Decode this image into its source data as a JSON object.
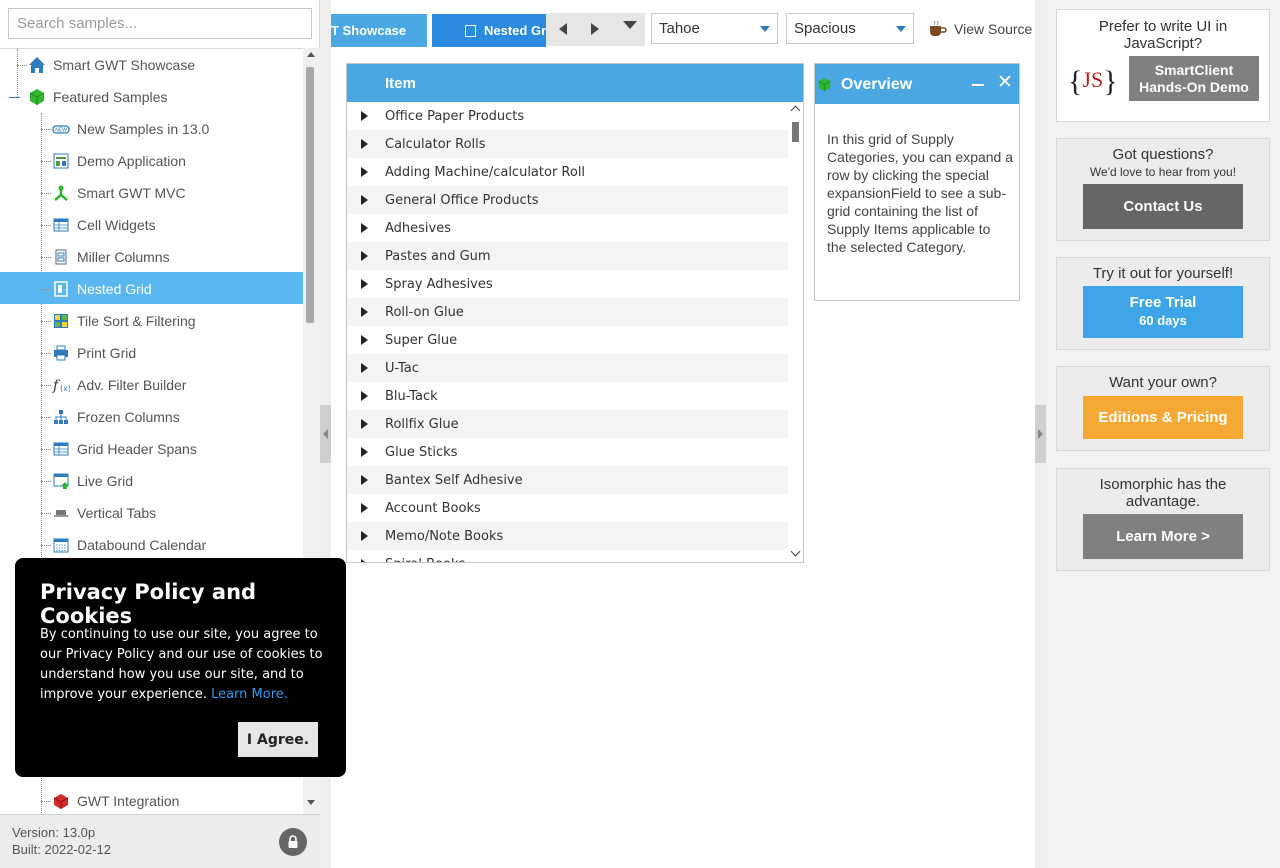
{
  "search": {
    "placeholder": "Search samples..."
  },
  "tree": {
    "root": "Smart GWT Showcase",
    "featured": "Featured Samples",
    "items": [
      {
        "label": "New Samples in 13.0",
        "icon": "new-badge-icon"
      },
      {
        "label": "Demo Application",
        "icon": "app-window-icon"
      },
      {
        "label": "Smart GWT MVC",
        "icon": "mvc-icon"
      },
      {
        "label": "Cell Widgets",
        "icon": "table-icon"
      },
      {
        "label": "Miller Columns",
        "icon": "columns-icon"
      },
      {
        "label": "Nested Grid",
        "icon": "nested-grid-icon"
      },
      {
        "label": "Tile Sort & Filtering",
        "icon": "tiles-icon"
      },
      {
        "label": "Print Grid",
        "icon": "printer-icon"
      },
      {
        "label": "Adv. Filter Builder",
        "icon": "function-icon"
      },
      {
        "label": "Frozen Columns",
        "icon": "hierarchy-icon"
      },
      {
        "label": "Grid Header Spans",
        "icon": "table-icon"
      },
      {
        "label": "Live Grid",
        "icon": "live-grid-icon"
      },
      {
        "label": "Vertical Tabs",
        "icon": "tabs-icon"
      },
      {
        "label": "Databound Calendar",
        "icon": "calendar-icon"
      }
    ],
    "bottom_item": {
      "label": "GWT Integration",
      "icon": "gwt-icon"
    },
    "selected": "Nested Grid"
  },
  "footer": {
    "version": "Version: 13.0p",
    "built": "Built: 2022-02-12"
  },
  "tabs": {
    "showcase": "T Showcase",
    "nested": "Nested Grid"
  },
  "selects": {
    "skin": "Tahoe",
    "density": "Spacious"
  },
  "view_source": "View Source",
  "grid": {
    "header": "Item",
    "rows": [
      "Office Paper Products",
      "Calculator Rolls",
      "Adding Machine/calculator Roll",
      "General Office Products",
      "Adhesives",
      "Pastes and Gum",
      "Spray Adhesives",
      "Roll-on Glue",
      "Super Glue",
      "U-Tac",
      "Blu-Tack",
      "Rollfix Glue",
      "Glue Sticks",
      "Bantex Self Adhesive",
      "Account Books",
      "Memo/Note Books",
      "Spiral Books"
    ]
  },
  "overview": {
    "title": "Overview",
    "body": "In this grid of Supply Categories, you can expand a row by clicking the special expansionField to see a sub-grid containing the list of Supply Items applicable to the selected Category."
  },
  "right": {
    "js_prompt": "Prefer to write UI in JavaScript?",
    "js_logo": "{JS}",
    "js_button": [
      "SmartClient",
      "Hands-On Demo"
    ],
    "questions": "Got questions?",
    "questions_sub": "We'd love to hear from you!",
    "contact": "Contact Us",
    "try": "Try it out for yourself!",
    "trial": [
      "Free Trial",
      "60 days"
    ],
    "want": "Want your own?",
    "editions": "Editions & Pricing",
    "iso": "Isomorphic has the advantage.",
    "learn": "Learn More >"
  },
  "privacy": {
    "title": "Privacy Policy and Cookies",
    "body": "By continuing to use our site, you agree to our Privacy Policy and our use of cookies to understand how you use our site, and to improve your experience.",
    "link": "Learn More.",
    "agree": "I Agree."
  },
  "colors": {
    "accent": "#4ba7e4",
    "selected_row": "#5bb7f2",
    "contact": "#666666",
    "trial": "#3ea6e8",
    "editions": "#f5a833",
    "learn": "#808080"
  }
}
